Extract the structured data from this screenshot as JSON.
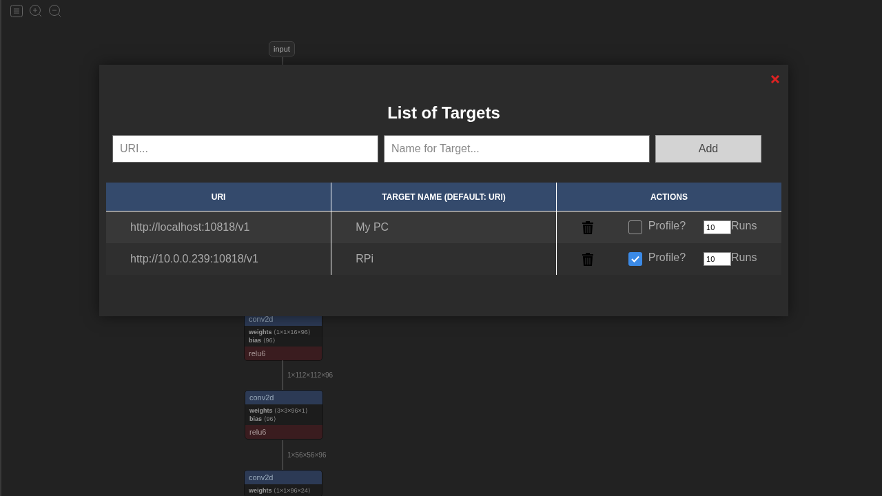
{
  "graph": {
    "nodes": [
      {
        "kind": "input",
        "label": "input"
      },
      {
        "kind": "op",
        "title": "conv2d",
        "attributes": [
          {
            "name": "weights",
            "value": "⟨1×1×16×96⟩"
          },
          {
            "name": "bias",
            "value": "⟨96⟩"
          }
        ],
        "activation": "relu6"
      },
      {
        "kind": "op",
        "title": "conv2d",
        "attributes": [
          {
            "name": "weights",
            "value": "⟨3×3×96×1⟩"
          },
          {
            "name": "bias",
            "value": "⟨96⟩"
          }
        ],
        "activation": "relu6"
      },
      {
        "kind": "op",
        "title": "conv2d",
        "attributes": [
          {
            "name": "weights",
            "value": "⟨1×1×96×24⟩"
          }
        ]
      }
    ],
    "edges": [
      {
        "label": "1×112×112×96"
      },
      {
        "label": "1×56×56×96"
      }
    ]
  },
  "dialog": {
    "title": "List of Targets",
    "uri_field": {
      "placeholder": "URI..."
    },
    "name_field": {
      "placeholder": "Name for Target..."
    },
    "add_button": "Add",
    "table": {
      "columns": [
        "URI",
        "TARGET NAME (DEFAULT: URI)",
        "ACTIONS"
      ],
      "rows": [
        {
          "uri": "http://localhost:10818/v1",
          "name": "My PC",
          "profile_label": "Profile?",
          "profile": false,
          "runs": "10",
          "runs_label": "Runs"
        },
        {
          "uri": "http://10.0.0.239:10818/v1",
          "name": "RPi",
          "profile_label": "Profile?",
          "profile": true,
          "runs": "10",
          "runs_label": "Runs"
        }
      ]
    }
  }
}
